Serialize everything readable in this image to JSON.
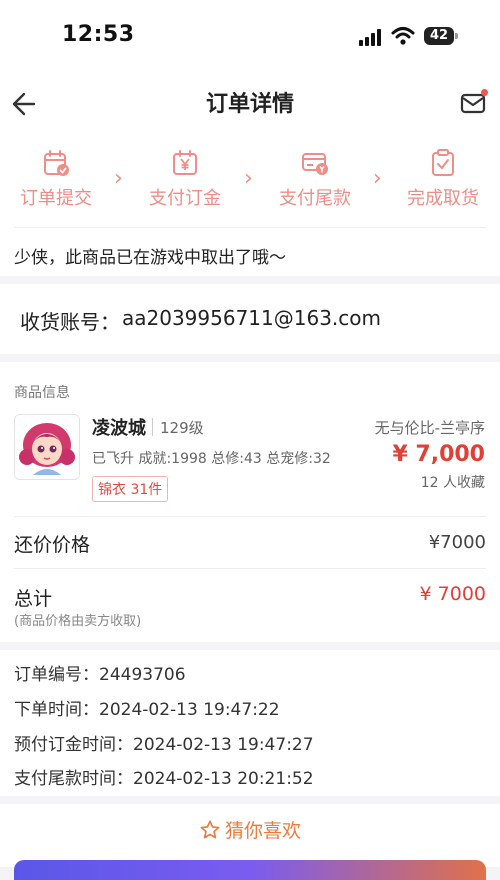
{
  "status_bar": {
    "time": "12:53",
    "battery": "42"
  },
  "nav": {
    "title": "订单详情"
  },
  "steps": [
    {
      "label": "订单提交",
      "icon": "calendar-check-icon"
    },
    {
      "label": "支付订金",
      "icon": "yen-calendar-icon"
    },
    {
      "label": "支付尾款",
      "icon": "yen-card-icon"
    },
    {
      "label": "完成取货",
      "icon": "clipboard-check-icon"
    }
  ],
  "step_arrow": "›",
  "notice": "少侠，此商品已在游戏中取出了哦～",
  "account": {
    "label": "收货账号：",
    "value": "aa2039956711@163.com"
  },
  "goods": {
    "section_title": "商品信息",
    "server": "凌波城",
    "level": "129级",
    "region": "无与伦比-兰亭序",
    "stats": "已飞升 成就:1998 总修:43 总宠修:32",
    "price": "¥ 7,000",
    "tag": "锦衣 31件",
    "favorites": "12 人收藏",
    "counter_offer_label": "还价价格",
    "counter_offer_value": "¥7000",
    "total_label": "总计",
    "total_note": "(商品价格由卖方收取)",
    "total_value": "¥ 7000"
  },
  "order_info": [
    {
      "label": "订单编号：",
      "value": "24493706"
    },
    {
      "label": "下单时间：",
      "value": "2024-02-13 19:47:22"
    },
    {
      "label": "预付订金时间：",
      "value": "2024-02-13 19:47:27"
    },
    {
      "label": "支付尾款时间：",
      "value": "2024-02-13 20:21:52"
    }
  ],
  "guess": {
    "title": "猜你喜欢"
  },
  "colors": {
    "accent": "#e23f36",
    "step": "#f08d86",
    "guess": "#f07a3c"
  }
}
